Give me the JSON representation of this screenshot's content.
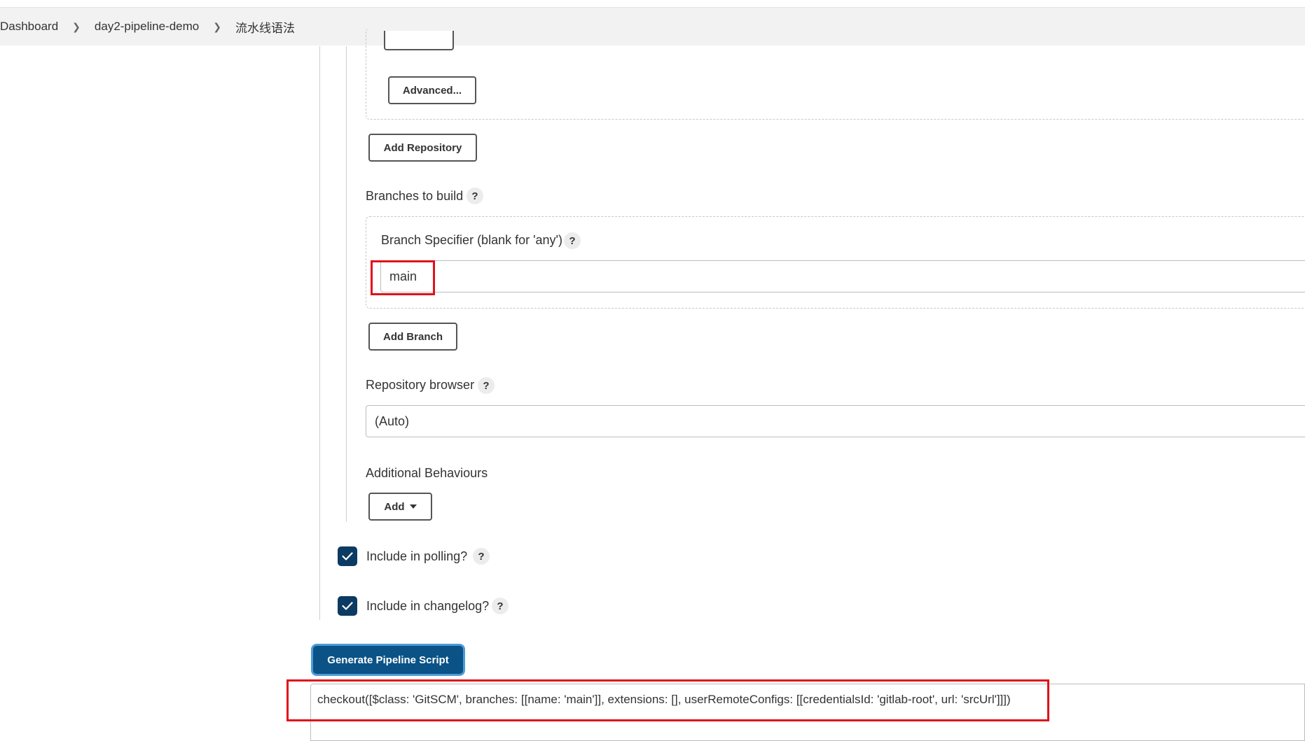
{
  "breadcrumb": [
    "Dashboard",
    "day2-pipeline-demo",
    "流水线语法"
  ],
  "buttons": {
    "advanced": "Advanced...",
    "add_repository": "Add Repository",
    "add_branch": "Add Branch",
    "add": "Add",
    "generate": "Generate Pipeline Script"
  },
  "branches": {
    "label": "Branches to build",
    "specifier_label": "Branch Specifier (blank for 'any')",
    "specifier_value": "main"
  },
  "repository_browser": {
    "label": "Repository browser",
    "value": "(Auto)"
  },
  "additional_behaviours": {
    "label": "Additional Behaviours"
  },
  "options": {
    "include_polling": {
      "label": "Include in polling?",
      "checked": true
    },
    "include_changelog": {
      "label": "Include in changelog?",
      "checked": true
    }
  },
  "generated_script": "checkout([$class: 'GitSCM', branches: [[name: 'main']], extensions: [], userRemoteConfigs: [[credentialsId: 'gitlab-root', url: 'srcUrl']]])",
  "help_glyph": "?",
  "colors": {
    "primary": "#0b5286",
    "checkbox": "#0b3a63",
    "highlight": "#e0111b"
  }
}
